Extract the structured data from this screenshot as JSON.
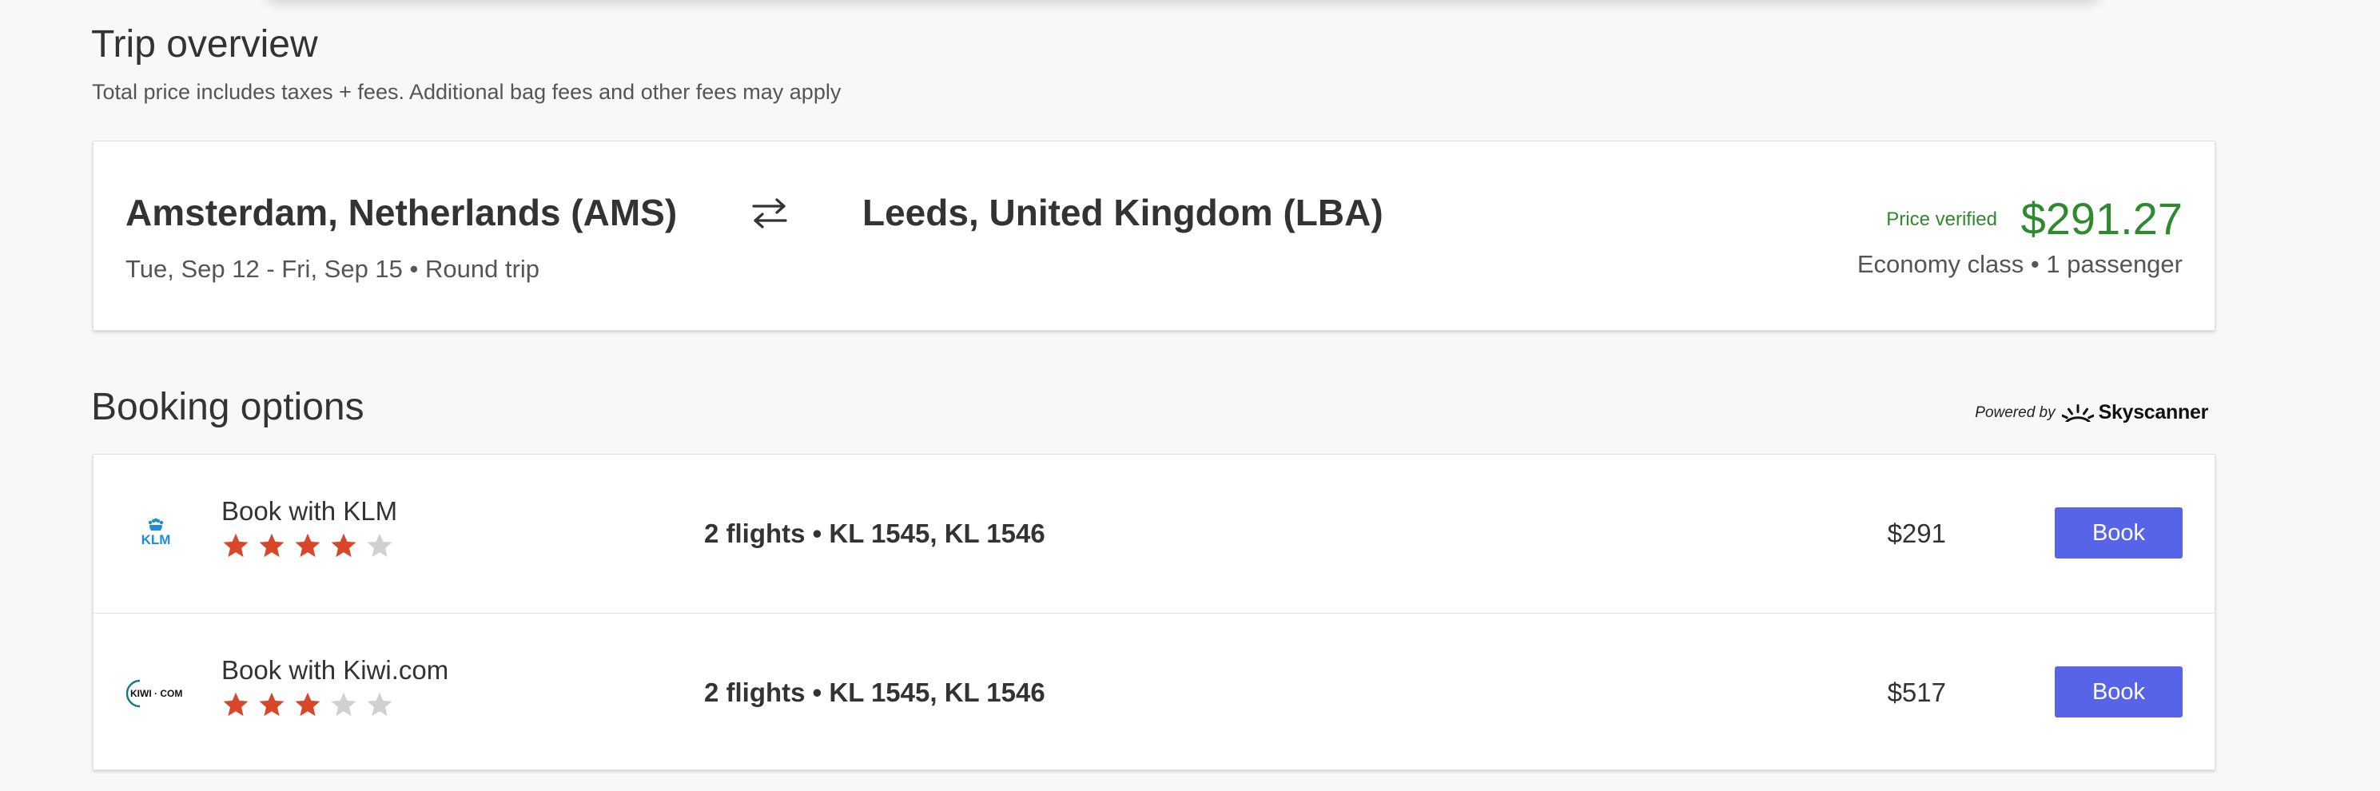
{
  "trip": {
    "title": "Trip overview",
    "subtitle": "Total price includes taxes + fees. Additional bag fees and other fees may apply",
    "origin": "Amsterdam, Netherlands (AMS)",
    "destination": "Leeds, United Kingdom (LBA)",
    "dates": "Tue, Sep 12 - Fri, Sep 15 • Round trip",
    "price_status": "Price verified",
    "total_price": "$291.27",
    "class_info": "Economy class • 1 passenger",
    "swap_icon": "swap-arrows-icon",
    "price_color": "#2f8a2f"
  },
  "booking": {
    "title": "Booking options",
    "powered_by": "Powered by",
    "brand": "Skyscanner",
    "options": [
      {
        "provider": "Book with KLM",
        "logo_text": "KLM",
        "rating": 4,
        "rating_max": 5,
        "flights": "2 flights • KL 1545, KL 1546",
        "price": "$291",
        "button": "Book"
      },
      {
        "provider": "Book with Kiwi.com",
        "logo_text": "KIWI · COM",
        "rating": 3,
        "rating_max": 5,
        "flights": "2 flights • KL 1545, KL 1546",
        "price": "$517",
        "button": "Book"
      }
    ]
  },
  "colors": {
    "accent_button": "#5764e8",
    "star_filled": "#d9472b",
    "star_empty": "#d0d0d0"
  }
}
